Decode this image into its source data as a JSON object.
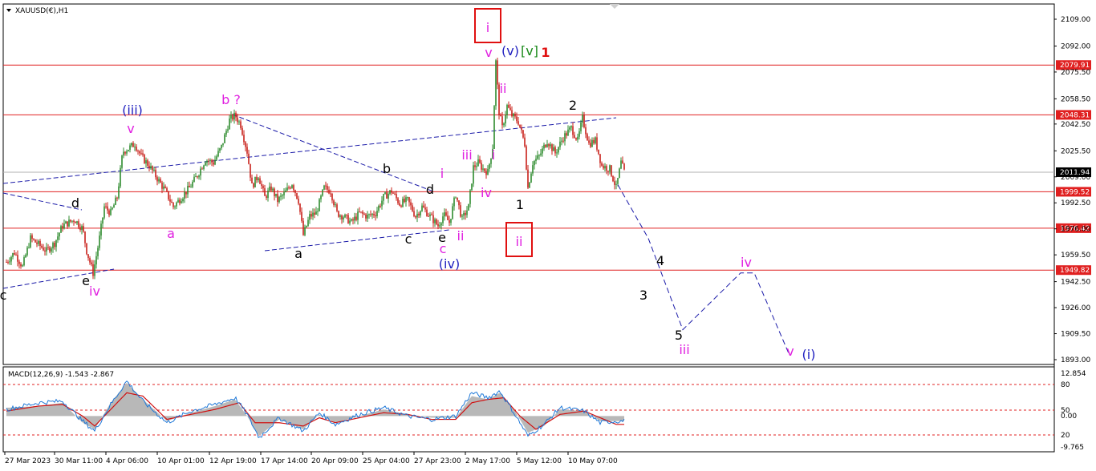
{
  "header": {
    "symbol_title": "XAUUSD(€),H1"
  },
  "macd_panel": {
    "title": "MACD(12,26,9) -1.543 -2.867",
    "y_ticks": [
      "12.854",
      "80",
      "50",
      "0.00",
      "20",
      "-9.765"
    ]
  },
  "colors": {
    "candle_up": "#2e8b2e",
    "candle_down": "#c8201a",
    "resistance_line": "#e02020",
    "trend_line": "#1a1aa8",
    "wave_magenta": "#e020e0",
    "wave_blue": "#2020c0",
    "wave_black": "#000000",
    "wave_green": "#1a8a1a",
    "wave_red": "#e01010",
    "macd_hist": "#b8b8b8",
    "macd_main": "#1e78d8",
    "macd_signal": "#d01010"
  },
  "chart_data": {
    "type": "candlestick",
    "y_axis_ticks": [
      "2109.00",
      "2092.00",
      "2075.50",
      "2058.50",
      "2042.50",
      "2025.50",
      "2009.00",
      "1992.50",
      "1976.00",
      "1959.50",
      "1942.50",
      "1926.00",
      "1909.50",
      "1893.00"
    ],
    "x_axis_ticks": [
      "27 Mar 2023",
      "30 Mar 11:00",
      "4 Apr 06:00",
      "10 Apr 01:00",
      "12 Apr 19:00",
      "17 Apr 14:00",
      "20 Apr 09:00",
      "25 Apr 04:00",
      "27 Apr 23:00",
      "2 May 17:00",
      "5 May 12:00",
      "10 May 07:00"
    ],
    "ylim": [
      1893,
      2109
    ],
    "horizontal_levels": [
      {
        "label": "2079.91",
        "value": 2079.91
      },
      {
        "label": "2048.31",
        "value": 2048.31
      },
      {
        "label": "2011.94",
        "value": 2011.94,
        "current_price": true
      },
      {
        "label": "1999.52",
        "value": 1999.52
      },
      {
        "label": "1976.42",
        "value": 1976.42
      },
      {
        "label": "1949.82",
        "value": 1949.82
      }
    ],
    "price_path": [
      [
        0,
        1955
      ],
      [
        10,
        1961
      ],
      [
        20,
        1952
      ],
      [
        30,
        1970
      ],
      [
        40,
        1966
      ],
      [
        50,
        1962
      ],
      [
        60,
        1967
      ],
      [
        70,
        1978
      ],
      [
        85,
        1982
      ],
      [
        95,
        1976
      ],
      [
        100,
        1962
      ],
      [
        108,
        1948
      ],
      [
        115,
        1967
      ],
      [
        122,
        1990
      ],
      [
        130,
        1986
      ],
      [
        138,
        1996
      ],
      [
        145,
        2025
      ],
      [
        152,
        2027
      ],
      [
        160,
        2030
      ],
      [
        168,
        2022
      ],
      [
        178,
        2016
      ],
      [
        188,
        2008
      ],
      [
        198,
        2000
      ],
      [
        208,
        1990
      ],
      [
        218,
        1996
      ],
      [
        228,
        2002
      ],
      [
        238,
        2010
      ],
      [
        248,
        2020
      ],
      [
        258,
        2018
      ],
      [
        268,
        2028
      ],
      [
        278,
        2045
      ],
      [
        285,
        2048
      ],
      [
        292,
        2042
      ],
      [
        300,
        2025
      ],
      [
        306,
        2003
      ],
      [
        314,
        2010
      ],
      [
        322,
        1996
      ],
      [
        330,
        2002
      ],
      [
        338,
        1994
      ],
      [
        346,
        1998
      ],
      [
        356,
        2005
      ],
      [
        364,
        1994
      ],
      [
        370,
        1972
      ],
      [
        378,
        1984
      ],
      [
        386,
        1986
      ],
      [
        396,
        2002
      ],
      [
        404,
        2000
      ],
      [
        412,
        1986
      ],
      [
        420,
        1984
      ],
      [
        430,
        1980
      ],
      [
        440,
        1986
      ],
      [
        450,
        1984
      ],
      [
        460,
        1986
      ],
      [
        470,
        1996
      ],
      [
        480,
        2000
      ],
      [
        490,
        1992
      ],
      [
        500,
        1994
      ],
      [
        510,
        1984
      ],
      [
        518,
        1990
      ],
      [
        528,
        1984
      ],
      [
        538,
        1978
      ],
      [
        545,
        1985
      ],
      [
        552,
        1980
      ],
      [
        560,
        1998
      ],
      [
        568,
        1982
      ],
      [
        576,
        1990
      ],
      [
        582,
        2015
      ],
      [
        588,
        2018
      ],
      [
        594,
        2014
      ],
      [
        600,
        2012
      ],
      [
        606,
        2028
      ],
      [
        610,
        2082
      ],
      [
        614,
        2050
      ],
      [
        618,
        2040
      ],
      [
        624,
        2054
      ],
      [
        630,
        2048
      ],
      [
        638,
        2044
      ],
      [
        646,
        2030
      ],
      [
        650,
        2002
      ],
      [
        656,
        2018
      ],
      [
        664,
        2022
      ],
      [
        674,
        2032
      ],
      [
        684,
        2024
      ],
      [
        694,
        2034
      ],
      [
        704,
        2040
      ],
      [
        712,
        2032
      ],
      [
        718,
        2046
      ],
      [
        726,
        2030
      ],
      [
        734,
        2032
      ],
      [
        742,
        2016
      ],
      [
        752,
        2014
      ],
      [
        760,
        2002
      ],
      [
        766,
        2018
      ],
      [
        770,
        2012
      ]
    ],
    "projection_path": [
      [
        762,
        2004
      ],
      [
        800,
        1970
      ],
      [
        843,
        1912
      ],
      [
        915,
        1948
      ],
      [
        932,
        1948
      ],
      [
        975,
        1897
      ]
    ],
    "macd": {
      "ylim": [
        -9.765,
        12.854
      ],
      "histogram": [
        [
          0,
          2.5
        ],
        [
          40,
          3
        ],
        [
          70,
          4
        ],
        [
          95,
          -2
        ],
        [
          110,
          -4
        ],
        [
          130,
          4
        ],
        [
          150,
          10
        ],
        [
          170,
          5
        ],
        [
          200,
          -1.5
        ],
        [
          230,
          1
        ],
        [
          260,
          3
        ],
        [
          285,
          5
        ],
        [
          300,
          0
        ],
        [
          315,
          -6
        ],
        [
          340,
          -1
        ],
        [
          370,
          -4
        ],
        [
          390,
          0.5
        ],
        [
          410,
          -2
        ],
        [
          440,
          0
        ],
        [
          470,
          2
        ],
        [
          500,
          0.5
        ],
        [
          530,
          -0.5
        ],
        [
          560,
          -0.5
        ],
        [
          580,
          6
        ],
        [
          600,
          5
        ],
        [
          615,
          7
        ],
        [
          630,
          3
        ],
        [
          650,
          -5
        ],
        [
          670,
          -3
        ],
        [
          690,
          2
        ],
        [
          720,
          1.5
        ],
        [
          740,
          -1.5
        ],
        [
          760,
          -1.5
        ],
        [
          770,
          -1.5
        ]
      ],
      "signal": [
        [
          0,
          1.5
        ],
        [
          40,
          3
        ],
        [
          70,
          3.5
        ],
        [
          95,
          0
        ],
        [
          110,
          -3
        ],
        [
          130,
          2
        ],
        [
          150,
          7
        ],
        [
          170,
          6
        ],
        [
          200,
          -1
        ],
        [
          230,
          0.5
        ],
        [
          260,
          2
        ],
        [
          290,
          4
        ],
        [
          310,
          -2
        ],
        [
          340,
          -2
        ],
        [
          370,
          -3
        ],
        [
          390,
          -0.5
        ],
        [
          410,
          -2
        ],
        [
          440,
          -0.5
        ],
        [
          470,
          1
        ],
        [
          500,
          0.5
        ],
        [
          530,
          -1
        ],
        [
          560,
          -1
        ],
        [
          580,
          4
        ],
        [
          600,
          5
        ],
        [
          620,
          5.5
        ],
        [
          640,
          0
        ],
        [
          660,
          -4
        ],
        [
          690,
          0.5
        ],
        [
          720,
          1.5
        ],
        [
          740,
          -0.5
        ],
        [
          760,
          -2.5
        ],
        [
          770,
          -2.5
        ]
      ],
      "main": [
        [
          0,
          2
        ],
        [
          40,
          4
        ],
        [
          70,
          4.5
        ],
        [
          95,
          -1.5
        ],
        [
          110,
          -4.5
        ],
        [
          130,
          3.5
        ],
        [
          150,
          10.5
        ],
        [
          170,
          4.5
        ],
        [
          200,
          -2
        ],
        [
          230,
          1.5
        ],
        [
          260,
          3.5
        ],
        [
          285,
          5.5
        ],
        [
          300,
          0.5
        ],
        [
          315,
          -6.5
        ],
        [
          340,
          -0.5
        ],
        [
          370,
          -4.5
        ],
        [
          390,
          1
        ],
        [
          410,
          -2.5
        ],
        [
          440,
          0.5
        ],
        [
          470,
          2.5
        ],
        [
          500,
          0
        ],
        [
          530,
          -1
        ],
        [
          560,
          0
        ],
        [
          580,
          7
        ],
        [
          600,
          5.5
        ],
        [
          615,
          7.5
        ],
        [
          630,
          2
        ],
        [
          650,
          -6
        ],
        [
          670,
          -2.5
        ],
        [
          690,
          2.5
        ],
        [
          720,
          1.5
        ],
        [
          740,
          -2
        ],
        [
          760,
          -1.5
        ],
        [
          770,
          -1.5
        ]
      ]
    },
    "wave_labels": [
      {
        "text": "i",
        "color": "magenta",
        "boxed": true
      },
      {
        "text": "v",
        "color": "magenta"
      },
      {
        "text": "(v)",
        "color": "blue"
      },
      {
        "text": "[v]",
        "color": "green"
      },
      {
        "text": "1",
        "color": "red"
      },
      {
        "text": "ii",
        "color": "magenta"
      },
      {
        "text": "2",
        "color": "black"
      },
      {
        "text": "(iii)",
        "color": "blue"
      },
      {
        "text": "v",
        "color": "magenta"
      },
      {
        "text": "b ?",
        "color": "magenta"
      },
      {
        "text": "iii",
        "color": "magenta"
      },
      {
        "text": "i",
        "color": "magenta"
      },
      {
        "text": "b",
        "color": "black"
      },
      {
        "text": "i",
        "color": "magenta"
      },
      {
        "text": "d",
        "color": "black"
      },
      {
        "text": "iv",
        "color": "magenta"
      },
      {
        "text": "d",
        "color": "black"
      },
      {
        "text": "1",
        "color": "black"
      },
      {
        "text": "a",
        "color": "magenta"
      },
      {
        "text": "ii",
        "color": "magenta",
        "boxed": true
      },
      {
        "text": "c",
        "color": "black"
      },
      {
        "text": "e",
        "color": "black"
      },
      {
        "text": "ii",
        "color": "magenta"
      },
      {
        "text": "a",
        "color": "black"
      },
      {
        "text": "c",
        "color": "magenta"
      },
      {
        "text": "(iv)",
        "color": "blue"
      },
      {
        "text": "4",
        "color": "black"
      },
      {
        "text": "iv",
        "color": "magenta"
      },
      {
        "text": "e",
        "color": "black"
      },
      {
        "text": "iv",
        "color": "magenta"
      },
      {
        "text": "c",
        "color": "black"
      },
      {
        "text": "3",
        "color": "black"
      },
      {
        "text": "5",
        "color": "black"
      },
      {
        "text": "iii",
        "color": "magenta"
      },
      {
        "text": "v",
        "color": "magenta"
      },
      {
        "text": "(i)",
        "color": "blue"
      }
    ]
  }
}
